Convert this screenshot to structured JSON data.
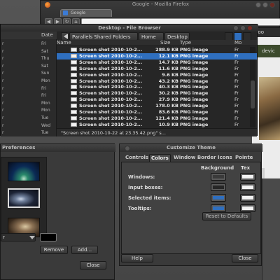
{
  "firefox": {
    "title": "Google - Mozilla Firefox",
    "tab_label": "Google",
    "url": ""
  },
  "webpage": {
    "header_text": "Goo",
    "device_label": "devic"
  },
  "file_browser": {
    "title": "Desktop - File Browser",
    "breadcrumbs": [
      "Parallels Shared Folders",
      "Home",
      "Desktop"
    ],
    "columns": {
      "name": "Name",
      "size": "Size",
      "type": "Type",
      "modified": "Mo",
      "left_date": "Date"
    },
    "left_rows": [
      {
        "name": "r",
        "date": "Fri"
      },
      {
        "name": "r",
        "date": "Sat"
      },
      {
        "name": "r",
        "date": "Thu"
      },
      {
        "name": "r",
        "date": "Sat"
      },
      {
        "name": "r",
        "date": "Sun"
      },
      {
        "name": "r",
        "date": "Mon"
      },
      {
        "name": "r",
        "date": "Fri"
      },
      {
        "name": "r",
        "date": "Fri"
      },
      {
        "name": "r",
        "date": "Mon"
      },
      {
        "name": "r",
        "date": "Mon"
      },
      {
        "name": "r",
        "date": "Tue"
      },
      {
        "name": "r",
        "date": "Wed"
      },
      {
        "name": "r",
        "date": "Tue"
      }
    ],
    "files": [
      {
        "name": "Screen shot 2010-10-2...",
        "size": "288.9 KB",
        "type": "PNG image",
        "modified": "Fr"
      },
      {
        "name": "Screen shot 2010-10-2...",
        "size": "12.1 KB",
        "type": "PNG image",
        "modified": "Fr",
        "selected": true
      },
      {
        "name": "Screen shot 2010-10-2...",
        "size": "14.7 KB",
        "type": "PNG image",
        "modified": "Fr"
      },
      {
        "name": "Screen shot 2010-10-2...",
        "size": "11.6 KB",
        "type": "PNG image",
        "modified": "Fr"
      },
      {
        "name": "Screen shot 2010-10-2...",
        "size": "9.6 KB",
        "type": "PNG image",
        "modified": "Fr"
      },
      {
        "name": "Screen shot 2010-10-2...",
        "size": "43.2 KB",
        "type": "PNG image",
        "modified": "Fr"
      },
      {
        "name": "Screen shot 2010-10-2...",
        "size": "40.3 KB",
        "type": "PNG image",
        "modified": "Fr"
      },
      {
        "name": "Screen shot 2010-10-2...",
        "size": "30.2 KB",
        "type": "PNG image",
        "modified": "Fr"
      },
      {
        "name": "Screen shot 2010-10-2...",
        "size": "27.9 KB",
        "type": "PNG image",
        "modified": "Fr"
      },
      {
        "name": "Screen shot 2010-10-2...",
        "size": "178.0 KB",
        "type": "PNG image",
        "modified": "Fr"
      },
      {
        "name": "Screen shot 2010-10-2...",
        "size": "83.6 KB",
        "type": "PNG image",
        "modified": "Fr"
      },
      {
        "name": "Screen shot 2010-10-2...",
        "size": "121.4 KB",
        "type": "PNG image",
        "modified": "Fr"
      },
      {
        "name": "Screen shot 2010-10-2...",
        "size": "10.9 KB",
        "type": "PNG image",
        "modified": "Fr"
      }
    ],
    "status": "\"Screen shot 2010-10-22 at 23.35.42.png\" s..."
  },
  "preferences": {
    "title": "Preferences",
    "select_value": "r",
    "remove_label": "Remove",
    "add_label": "Add...",
    "close_label": "Close"
  },
  "customize_theme": {
    "title": "Customize Theme",
    "tabs": [
      "Controls",
      "Colors",
      "Window Border",
      "Icons",
      "Pointe"
    ],
    "active_tab": "Colors",
    "col_background": "Background",
    "col_text": "Tex",
    "rows": [
      {
        "label": "Windows:",
        "bg": "#3a3a3a",
        "text": "#f2f2f2"
      },
      {
        "label": "Input boxes:",
        "bg": "#262626",
        "text": "#f2f2f2"
      },
      {
        "label": "Selected items:",
        "bg": "#2f6fbf",
        "text": "#f2f2f2"
      },
      {
        "label": "Tooltips:",
        "bg": "#2f6fbf",
        "text": "#f2f2f2"
      }
    ],
    "reset_label": "Reset to Defaults",
    "help_label": "Help",
    "close_label": "Close"
  },
  "colors": {
    "selection": "#2f6fbf",
    "panel": "#3a3a3a",
    "dark": "#262626"
  }
}
